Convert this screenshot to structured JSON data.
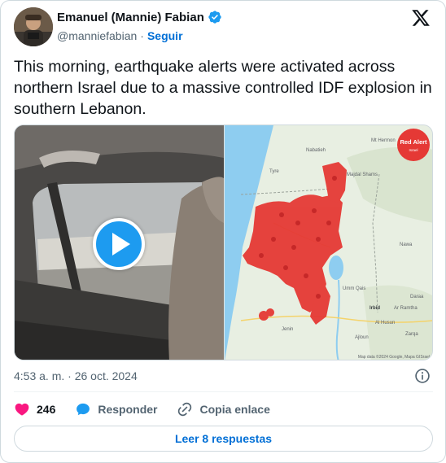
{
  "author": {
    "name": "Emanuel (Mannie) Fabian",
    "handle": "@manniefabian",
    "separator": "·",
    "follow_label": "Seguir"
  },
  "tweet": {
    "text": "This morning, earthquake alerts were activated across northern Israel due to a massive controlled IDF explosion in southern Lebanon.",
    "timestamp": "4:53 a. m. · 26 oct. 2024"
  },
  "map": {
    "badge_line1": "Red Alert",
    "badge_line2": "Israel",
    "labels": [
      "Mt Hermon",
      "Nabatieh",
      "Tyre",
      "Majdal Shams",
      "Nawa",
      "Umm Qais",
      "Irbid",
      "Ar Ramtha",
      "Daraa",
      "Jenin",
      "Al Husun",
      "Ajloun",
      "Zarqa"
    ],
    "attribution": "Map data ©2024 Google, Mapa GISrael"
  },
  "actions": {
    "like_count": "246",
    "reply_label": "Responder",
    "copy_link_label": "Copia enlace",
    "read_replies_label": "Leer 8 respuestas"
  },
  "colors": {
    "link_blue": "#006fd6",
    "play_blue": "#1d9bf0",
    "like_pink": "#f91880",
    "alert_red": "#e53935"
  },
  "icons": {
    "verified": "verified-badge-icon",
    "x_logo": "x-logo-icon",
    "play": "play-icon",
    "info": "info-icon",
    "heart": "heart-icon",
    "reply": "reply-bubble-icon",
    "link": "link-icon"
  }
}
